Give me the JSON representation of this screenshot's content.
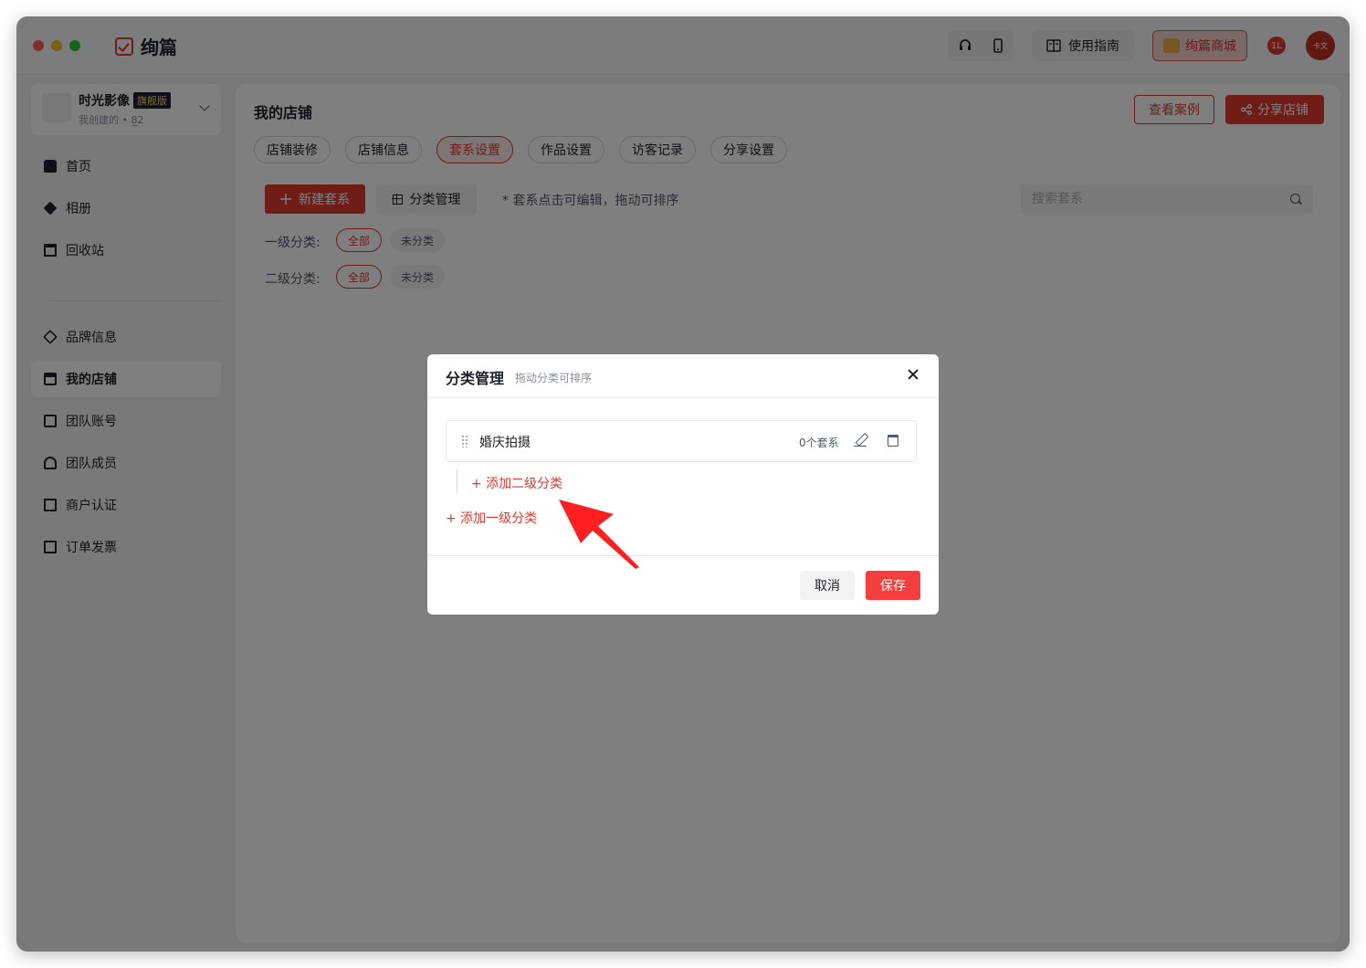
{
  "app": {
    "title": "绚篇",
    "guide_label": "使用指南",
    "mall_label": "绚篇商城",
    "badge_text": "1L",
    "avatar_text": "卡文"
  },
  "org": {
    "name": "时光影像",
    "tag": "旗舰版",
    "sub": "我创建的 • 8̲2"
  },
  "nav": {
    "items": [
      {
        "label": "首页",
        "icon": "home-icon"
      },
      {
        "label": "相册",
        "icon": "album-icon"
      },
      {
        "label": "回收站",
        "icon": "trash-icon"
      },
      {
        "label": "品牌信息",
        "icon": "brand-icon"
      },
      {
        "label": "我的店铺",
        "icon": "shop-icon"
      },
      {
        "label": "团队账号",
        "icon": "team-account-icon"
      },
      {
        "label": "团队成员",
        "icon": "team-member-icon"
      },
      {
        "label": "商户认证",
        "icon": "certificate-icon"
      },
      {
        "label": "订单发票",
        "icon": "invoice-icon"
      }
    ],
    "active": "我的店铺"
  },
  "main": {
    "title": "我的店铺",
    "view_cases": "查看案例",
    "share_shop": "分享店铺",
    "tabs": [
      "店铺装修",
      "店铺信息",
      "套系设置",
      "作品设置",
      "访客记录",
      "分享设置"
    ],
    "active_tab": "套系设置",
    "new_set": "新建套系",
    "cat_manage": "分类管理",
    "hint": "* 套系点击可编辑，拖动可排序",
    "search_placeholder": "搜索套系",
    "level1_label": "一级分类:",
    "level2_label": "二级分类:",
    "chip_all": "全部",
    "chip_uncat": "未分类"
  },
  "modal": {
    "title": "分类管理",
    "subtitle": "拖动分类可排序",
    "category": {
      "name": "婚庆拍摄",
      "count": "0个套系"
    },
    "add_sub": "+ 添加二级分类",
    "add_top": "+ 添加一级分类",
    "cancel": "取消",
    "save": "保存"
  },
  "colors": {
    "accent": "#e03a2f",
    "save": "#f53f3f"
  }
}
